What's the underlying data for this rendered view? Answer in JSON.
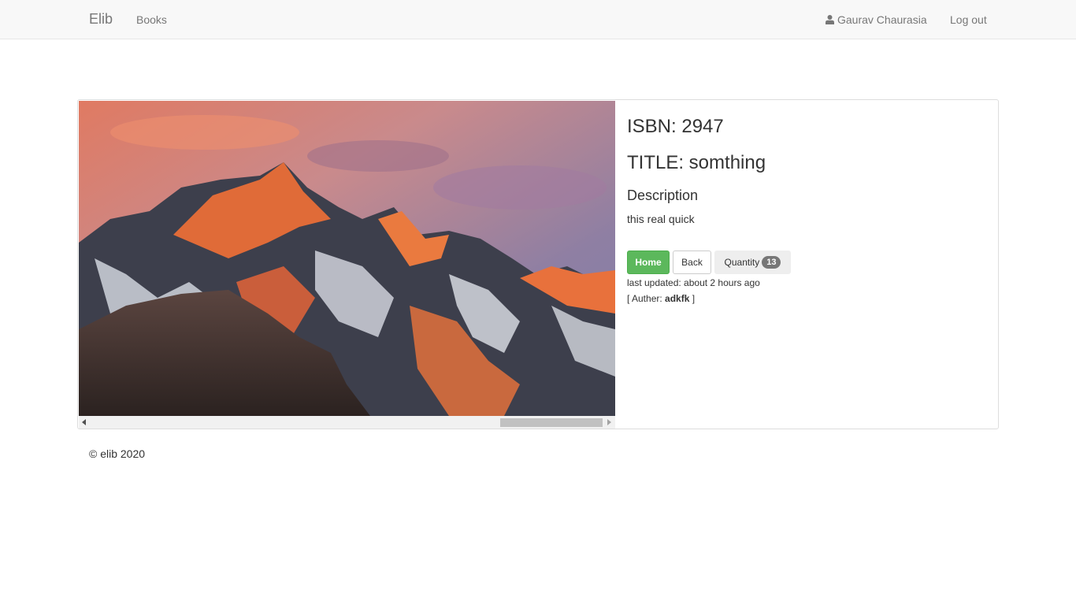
{
  "nav": {
    "brand": "Elib",
    "books": "Books",
    "user": "Gaurav Chaurasia",
    "user_icon": "user-icon",
    "logout": "Log out"
  },
  "book": {
    "image_alt": "macOS Sierra mountain landscape",
    "isbn": "ISBN: 2947",
    "title": "TITLE: somthing",
    "description_heading": "Description",
    "description": "this real quick",
    "updated": "last updated: about 2 hours ago",
    "author_prefix": "[ Auther: ",
    "author_name": "adkfk",
    "author_suffix": " ]"
  },
  "actions": {
    "home": "Home",
    "back": "Back",
    "quantity_label": "Quantity",
    "quantity_value": "13"
  },
  "footer": {
    "copyright": "© elib 2020"
  },
  "colors": {
    "home_button": "#5cb85c",
    "navbar_bg": "#f8f8f8",
    "badge": "#777777"
  }
}
